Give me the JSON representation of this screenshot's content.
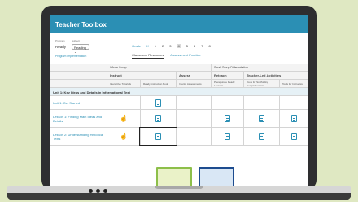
{
  "app": {
    "title": "Teacher Toolbox"
  },
  "controls": {
    "program_label": "Program",
    "program_value": "Ready",
    "subject_label": "Subject",
    "subject_value": "Reading",
    "implementation_link": "Program Implementation"
  },
  "grades": {
    "label": "Grade",
    "items": [
      "K",
      "1",
      "2",
      "3",
      "4",
      "5",
      "6",
      "7",
      "8"
    ],
    "selected": "4"
  },
  "tabs": [
    "Classroom Resources",
    "Assessment Practice"
  ],
  "table": {
    "group_headers": [
      "Whole Group",
      "Small Group Differentiation"
    ],
    "column_headers": [
      "Instruct",
      "Assess",
      "Reteach",
      "Teacher-Led Activities"
    ],
    "sub_headers": [
      "Interactive Tutorials",
      "Ready Instruction Book",
      "Interim Assessments",
      "Prerequisite Ready Lessons",
      "Tools for Scaffolding Comprehension",
      "Tools for Instruction"
    ],
    "section": "Unit 1: Key Ideas and Details in Informational Text",
    "rows": [
      {
        "label": "Unit 1: Get Started"
      },
      {
        "label": "Lesson 1: Finding Main Ideas and Details"
      },
      {
        "label": "Lesson 2: Understanding Historical Texts"
      }
    ]
  },
  "icons": {
    "resource": "document-icon",
    "tutorial": "pointer-hand-icon"
  },
  "colors": {
    "header": "#2b8fb4",
    "section_bg": "#e6f1f6",
    "desk": "#dfe8c2"
  }
}
